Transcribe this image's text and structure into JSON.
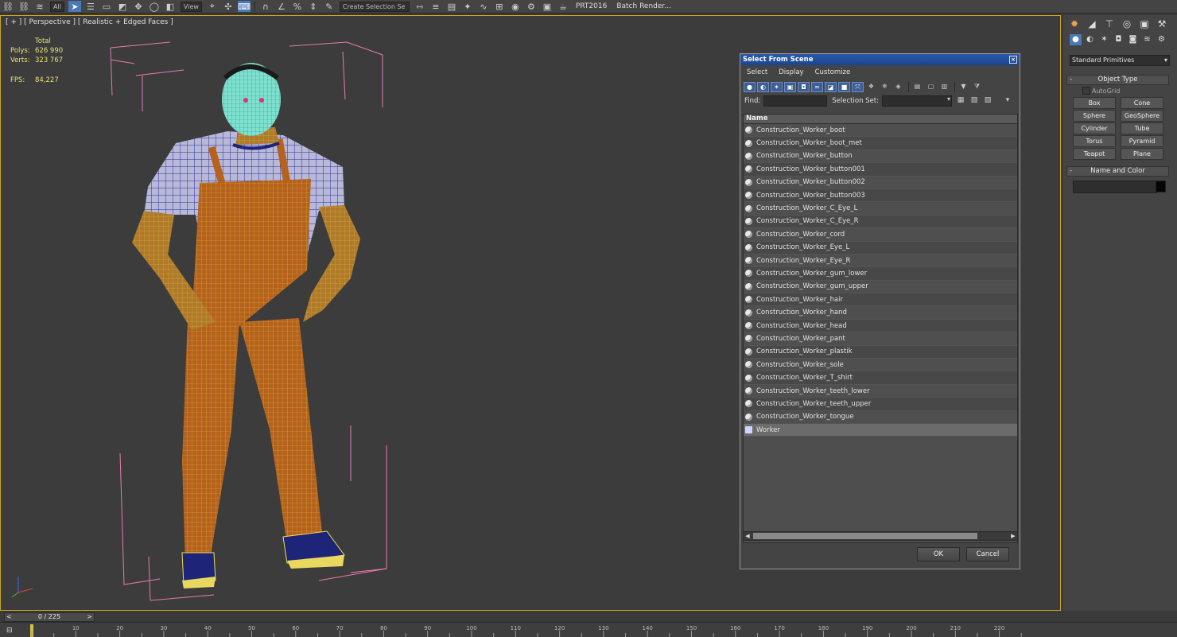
{
  "toolbar": {
    "filter_value": "All",
    "view_value": "View",
    "selection_set_placeholder": "Create Selection Se",
    "labels": [
      "PRT2016",
      "Batch Render..."
    ]
  },
  "viewport": {
    "label": "[ + ] [ Perspective ] [ Realistic + Edged Faces ]",
    "stats": {
      "total_label": "Total",
      "polys_label": "Polys:",
      "polys_value": "626 990",
      "verts_label": "Verts:",
      "verts_value": "323 767",
      "fps_label": "FPS:",
      "fps_value": "84,227"
    }
  },
  "dialog": {
    "title": "Select From Scene",
    "close": "×",
    "menu": [
      "Select",
      "Display",
      "Customize"
    ],
    "find_label": "Find:",
    "find_value": "",
    "selection_set_label": "Selection Set:",
    "column_header": "Name",
    "objects": [
      "Construction_Worker_boot",
      "Construction_Worker_boot_met",
      "Construction_Worker_button",
      "Construction_Worker_button001",
      "Construction_Worker_button002",
      "Construction_Worker_button003",
      "Construction_Worker_C_Eye_L",
      "Construction_Worker_C_Eye_R",
      "Construction_Worker_cord",
      "Construction_Worker_Eye_L",
      "Construction_Worker_Eye_R",
      "Construction_Worker_gum_lower",
      "Construction_Worker_gum_upper",
      "Construction_Worker_hair",
      "Construction_Worker_hand",
      "Construction_Worker_head",
      "Construction_Worker_pant",
      "Construction_Worker_plastik",
      "Construction_Worker_sole",
      "Construction_Worker_T_shirt",
      "Construction_Worker_teeth_lower",
      "Construction_Worker_teeth_upper",
      "Construction_Worker_tongue",
      "Worker"
    ],
    "selected_object": "Worker",
    "ok_label": "OK",
    "cancel_label": "Cancel"
  },
  "command_panel": {
    "category": "Standard Primitives",
    "object_type_title": "Object Type",
    "autogrid_label": "AutoGrid",
    "primitives": [
      "Box",
      "Cone",
      "Sphere",
      "GeoSphere",
      "Cylinder",
      "Tube",
      "Torus",
      "Pyramid",
      "Teapot",
      "Plane"
    ],
    "name_color_title": "Name and Color",
    "name_value": "",
    "color": "#050505",
    "rollout_toggle": "-"
  },
  "timeline": {
    "frame_display": "0 / 225",
    "prev_arrow": "<",
    "next_arrow": ">",
    "ticks": [
      10,
      20,
      30,
      40,
      50,
      60,
      70,
      80,
      90,
      100,
      110,
      120,
      130,
      140,
      150,
      160,
      170,
      180,
      190,
      200,
      210,
      220
    ]
  },
  "colors": {
    "accent": "#4a78b8",
    "stats_text": "#e8e078",
    "viewport_border": "#c9a428",
    "bbox_lines": "#e87ab0",
    "title_bar": "#2a5aa8"
  }
}
